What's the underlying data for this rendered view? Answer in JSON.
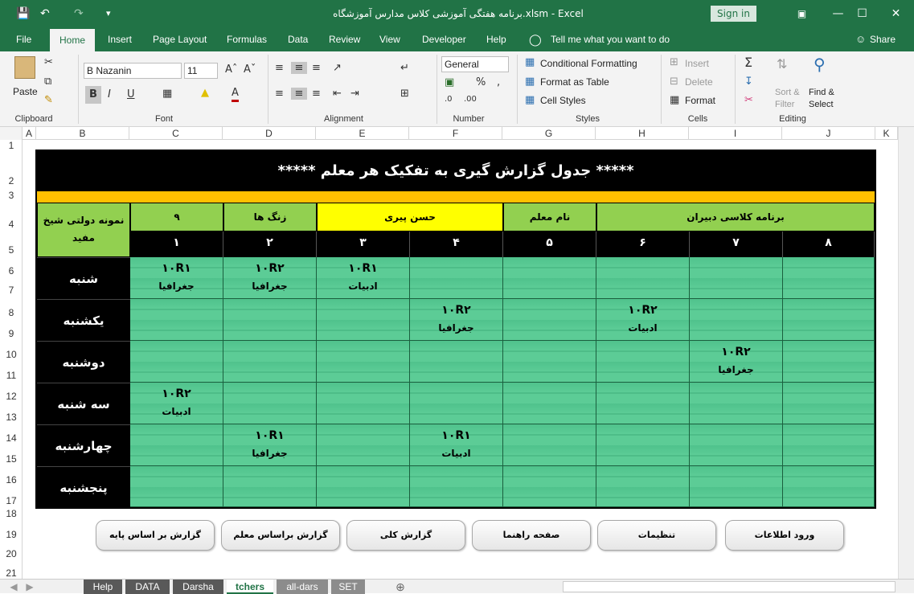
{
  "app": {
    "title": "برنامه هفتگی آموزشی کلاس مدارس آموزشگاه.xlsm  -  Excel",
    "signin": "Sign in",
    "share": "Share",
    "tell_me": "Tell me what you want to do"
  },
  "menu": [
    "File",
    "Home",
    "Insert",
    "Page Layout",
    "Formulas",
    "Data",
    "Review",
    "View",
    "Developer",
    "Help"
  ],
  "ribbon": {
    "clipboard": {
      "paste": "Paste",
      "label": "Clipboard"
    },
    "font": {
      "name": "B Nazanin",
      "size": "11",
      "label": "Font"
    },
    "alignment": {
      "label": "Alignment"
    },
    "number": {
      "format": "General",
      "label": "Number"
    },
    "styles": {
      "conditional": "Conditional Formatting",
      "format_table": "Format as Table",
      "cell_styles": "Cell Styles",
      "label": "Styles"
    },
    "cells": {
      "insert": "Insert",
      "delete": "Delete",
      "format": "Format",
      "label": "Cells"
    },
    "editing": {
      "sort": "Sort & Filter",
      "find": "Find & Select",
      "label": "Editing"
    }
  },
  "columns": [
    "A",
    "B",
    "C",
    "D",
    "E",
    "F",
    "G",
    "H",
    "I",
    "J",
    "K"
  ],
  "rows": [
    "1",
    "2",
    "3",
    "4",
    "5",
    "6",
    "7",
    "8",
    "9",
    "10",
    "11",
    "12",
    "13",
    "14",
    "15",
    "16",
    "17",
    "18",
    "19",
    "20",
    "21"
  ],
  "report": {
    "title": "***** جدول گزارش گیری به تفکیک هر معلم *****",
    "school": "نمونه دولتی شیخ مفید",
    "grade": "۹",
    "bell_label": "زنگ ها",
    "teacher_name": "حسن پیری",
    "teacher_label": "نام معلم",
    "program_label": "برنامه کلاسی دبیران",
    "periods": [
      "۱",
      "۲",
      "۳",
      "۴",
      "۵",
      "۶",
      "۷",
      "۸"
    ],
    "days": [
      "شنبه",
      "یکشنبه",
      "دوشنبه",
      "سه شنبه",
      "چهارشنبه",
      "پنجشنبه"
    ],
    "cells": [
      [
        {
          "code": "۱۰R۱",
          "subject": "جغرافیا"
        },
        {
          "code": "۱۰R۲",
          "subject": "جغرافیا"
        },
        {
          "code": "۱۰R۱",
          "subject": "ادبیات"
        },
        {
          "code": "",
          "subject": ""
        },
        {
          "code": "",
          "subject": ""
        },
        {
          "code": "",
          "subject": ""
        },
        {
          "code": "",
          "subject": ""
        },
        {
          "code": "",
          "subject": ""
        }
      ],
      [
        {
          "code": "",
          "subject": ""
        },
        {
          "code": "",
          "subject": ""
        },
        {
          "code": "",
          "subject": ""
        },
        {
          "code": "۱۰R۲",
          "subject": "جغرافیا"
        },
        {
          "code": "",
          "subject": ""
        },
        {
          "code": "۱۰R۲",
          "subject": "ادبیات"
        },
        {
          "code": "",
          "subject": ""
        },
        {
          "code": "",
          "subject": ""
        }
      ],
      [
        {
          "code": "",
          "subject": ""
        },
        {
          "code": "",
          "subject": ""
        },
        {
          "code": "",
          "subject": ""
        },
        {
          "code": "",
          "subject": ""
        },
        {
          "code": "",
          "subject": ""
        },
        {
          "code": "",
          "subject": ""
        },
        {
          "code": "۱۰R۲",
          "subject": "جغرافیا"
        },
        {
          "code": "",
          "subject": ""
        }
      ],
      [
        {
          "code": "۱۰R۲",
          "subject": "ادبیات"
        },
        {
          "code": "",
          "subject": ""
        },
        {
          "code": "",
          "subject": ""
        },
        {
          "code": "",
          "subject": ""
        },
        {
          "code": "",
          "subject": ""
        },
        {
          "code": "",
          "subject": ""
        },
        {
          "code": "",
          "subject": ""
        },
        {
          "code": "",
          "subject": ""
        }
      ],
      [
        {
          "code": "",
          "subject": ""
        },
        {
          "code": "۱۰R۱",
          "subject": "جغرافیا"
        },
        {
          "code": "",
          "subject": ""
        },
        {
          "code": "۱۰R۱",
          "subject": "ادبیات"
        },
        {
          "code": "",
          "subject": ""
        },
        {
          "code": "",
          "subject": ""
        },
        {
          "code": "",
          "subject": ""
        },
        {
          "code": "",
          "subject": ""
        }
      ],
      [
        {
          "code": "",
          "subject": ""
        },
        {
          "code": "",
          "subject": ""
        },
        {
          "code": "",
          "subject": ""
        },
        {
          "code": "",
          "subject": ""
        },
        {
          "code": "",
          "subject": ""
        },
        {
          "code": "",
          "subject": ""
        },
        {
          "code": "",
          "subject": ""
        },
        {
          "code": "",
          "subject": ""
        }
      ]
    ]
  },
  "buttons": [
    "گزارش بر اساس پایه",
    "گزارش براساس معلم",
    "گزارش کلی",
    "صفحه راهنما",
    "تنظیمات",
    "ورود اطلاعات"
  ],
  "sheet_tabs": [
    "Help",
    "DATA",
    "Darsha",
    "tchers",
    "all-dars",
    "SET"
  ],
  "colors": {
    "excel_green": "#217346",
    "header_green": "#92d050",
    "cell_green": "#5ccc96",
    "yellow": "#ffff00",
    "orange": "#ffc000"
  }
}
